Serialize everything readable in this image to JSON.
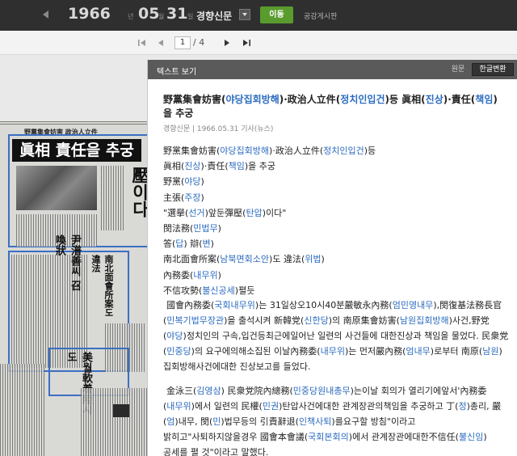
{
  "header": {
    "year": "1966",
    "year_unit": "년",
    "month": "05",
    "month_unit": "월",
    "day": "31",
    "day_unit": "일",
    "newspaper": "경향신문",
    "move_button": "이동",
    "board_link": "공감게시판"
  },
  "pager": {
    "current": "1",
    "total": "/ 4"
  },
  "panel": {
    "title": "텍스트 보기",
    "tab_original": "원문",
    "tab_korean": "한글변환"
  },
  "paper_image": {
    "headline": "眞相 責任을 추궁",
    "strap": "野黨集會妨害 政治人立件"
  },
  "article": {
    "title_parts": [
      {
        "t": "野黨集會妨害(",
        "c": false
      },
      {
        "t": "야당집회방해",
        "c": true
      },
      {
        "t": ")·政治人立件(",
        "c": false
      },
      {
        "t": "정치인입건",
        "c": true
      },
      {
        "t": ")등 眞相(",
        "c": false
      },
      {
        "t": "진상",
        "c": true
      },
      {
        "t": ")·責任(",
        "c": false
      },
      {
        "t": "책임",
        "c": true
      },
      {
        "t": ")을 추궁",
        "c": false
      }
    ],
    "meta": "경향신문 | 1966.05.31 기사(뉴스)",
    "lines": [
      [
        {
          "t": "野黨集會妨害(",
          "c": false
        },
        {
          "t": "야당집회방해",
          "c": true
        },
        {
          "t": ")·政治人立件(",
          "c": false
        },
        {
          "t": "정치인입건",
          "c": true
        },
        {
          "t": ")등",
          "c": false
        }
      ],
      [
        {
          "t": "眞相(",
          "c": false
        },
        {
          "t": "진상",
          "c": true
        },
        {
          "t": ")·責任(",
          "c": false
        },
        {
          "t": "책임",
          "c": true
        },
        {
          "t": ")을 추궁",
          "c": false
        }
      ],
      [
        {
          "t": "野黨(",
          "c": false
        },
        {
          "t": "야당",
          "c": true
        },
        {
          "t": ")",
          "c": false
        }
      ],
      [
        {
          "t": "主張(",
          "c": false
        },
        {
          "t": "주장",
          "c": true
        },
        {
          "t": ")",
          "c": false
        }
      ],
      [
        {
          "t": "\"選擧(",
          "c": false
        },
        {
          "t": "선거",
          "c": true
        },
        {
          "t": ")앞둔彈壓(",
          "c": false
        },
        {
          "t": "탄압",
          "c": true
        },
        {
          "t": ")이다\"",
          "c": false
        }
      ],
      [
        {
          "t": "閔法務(",
          "c": false
        },
        {
          "t": "민법무",
          "c": true
        },
        {
          "t": ")",
          "c": false
        }
      ],
      [
        {
          "t": "答(",
          "c": false
        },
        {
          "t": "답",
          "c": true
        },
        {
          "t": ") 辯(",
          "c": false
        },
        {
          "t": "변",
          "c": true
        },
        {
          "t": ")",
          "c": false
        }
      ],
      [
        {
          "t": "南北面會所案(",
          "c": false
        },
        {
          "t": "남북면회소안",
          "c": true
        },
        {
          "t": ")도 違法(",
          "c": false
        },
        {
          "t": "위법",
          "c": true
        },
        {
          "t": ")",
          "c": false
        }
      ],
      [
        {
          "t": "內務委(",
          "c": false
        },
        {
          "t": "내무위",
          "c": true
        },
        {
          "t": ")",
          "c": false
        }
      ],
      [
        {
          "t": "不信攻勢(",
          "c": false
        },
        {
          "t": "불신공세",
          "c": true
        },
        {
          "t": ")펼듯",
          "c": false
        }
      ]
    ],
    "para1": [
      {
        "t": "國會內務委(",
        "c": false
      },
      {
        "t": "국회내무위",
        "c": true
      },
      {
        "t": ")는 31일상오10시40분嚴敏永內務(",
        "c": false
      },
      {
        "t": "엄민영내무",
        "c": true
      },
      {
        "t": "),閔復基法務長官(",
        "c": false
      },
      {
        "t": "민복기법무장관",
        "c": true
      },
      {
        "t": ")을 출석시켜 新韓党(",
        "c": false
      },
      {
        "t": "신한당",
        "c": true
      },
      {
        "t": ")의 南原集會妨害(",
        "c": false
      },
      {
        "t": "남원집회방해",
        "c": true
      },
      {
        "t": ")사건,野党(",
        "c": false
      },
      {
        "t": "야당",
        "c": true
      },
      {
        "t": ")정치인의 구속,입건등최근에일어난 일련의 사건들에 대한진상과 책임을 물었다. 民衆党(",
        "c": false
      },
      {
        "t": "민중당",
        "c": true
      },
      {
        "t": ")의 요구에의해소집된 이날內務委(",
        "c": false
      },
      {
        "t": "내무위",
        "c": true
      },
      {
        "t": ")는 먼저嚴內務(",
        "c": false
      },
      {
        "t": "엄내무",
        "c": true
      },
      {
        "t": ")로부터 南原(",
        "c": false
      },
      {
        "t": "남원",
        "c": true
      },
      {
        "t": ")집회방해사건에대한 진상보고를 들었다.",
        "c": false
      }
    ],
    "para2": [
      {
        "t": "金泳三(",
        "c": false
      },
      {
        "t": "김영삼",
        "c": true
      },
      {
        "t": ") 民衆党院內總務(",
        "c": false
      },
      {
        "t": "민중당원내총무",
        "c": true
      },
      {
        "t": ")는이날 회의가 열리기에앞서'內務委(",
        "c": false
      },
      {
        "t": "내무위",
        "c": true
      },
      {
        "t": ")에서 일련의 民權(",
        "c": false
      },
      {
        "t": "민권",
        "c": true
      },
      {
        "t": ")탄압사건에대한 관계장관의책임을 추궁하고 丁(",
        "c": false
      },
      {
        "t": "정",
        "c": true
      },
      {
        "t": ")총리, 嚴(",
        "c": false
      },
      {
        "t": "엄",
        "c": true
      },
      {
        "t": ")내무, 閔(",
        "c": false
      },
      {
        "t": "민",
        "c": true
      },
      {
        "t": ")법무등의 引責辭退(",
        "c": false
      },
      {
        "t": "인책사퇴",
        "c": true
      },
      {
        "t": ")를요구할 방침\"이라고 밝히고\"사퇴하지않을경우 國會本會議(",
        "c": false
      },
      {
        "t": "국회본회의",
        "c": true
      },
      {
        "t": ")에서 관계장관에대한不信任(",
        "c": false
      },
      {
        "t": "불신임",
        "c": true
      },
      {
        "t": ")공세를 펼 것\"이라고 말했다.",
        "c": false
      }
    ]
  },
  "colors": {
    "topbar": "#2f2f2f",
    "accent_green": "#5a9b2e",
    "hangul_blue": "#2b6bbf",
    "panel_header": "#5a5a5a"
  }
}
